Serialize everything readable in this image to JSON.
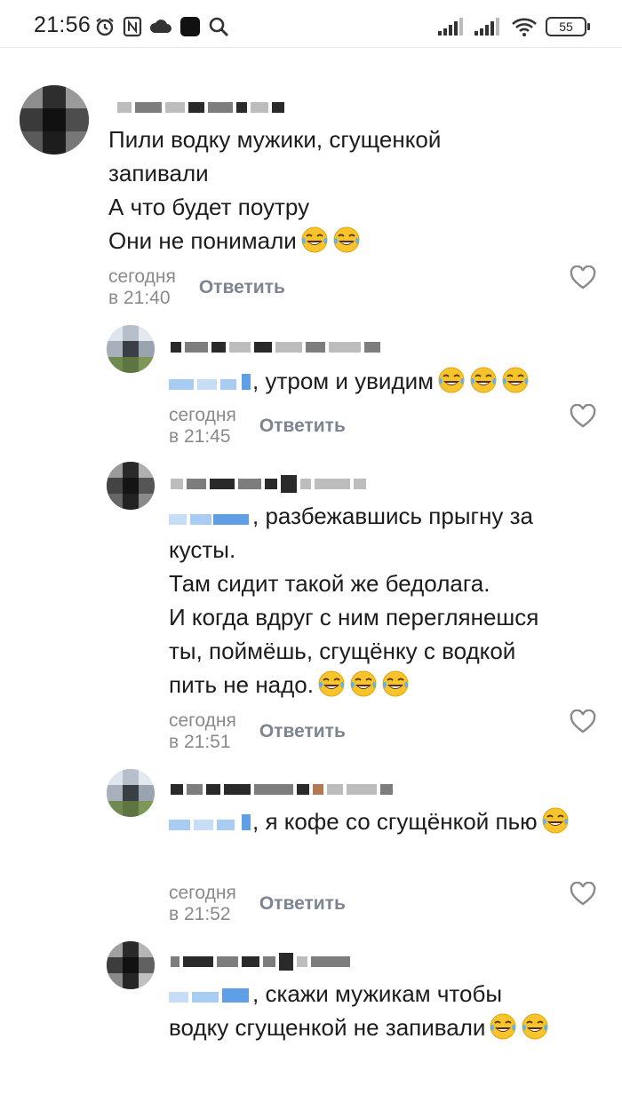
{
  "status_bar": {
    "time": "21:56",
    "left_icons": [
      "alarm-icon",
      "nfc-icon",
      "cloud-icon",
      "app-icon",
      "search-icon"
    ],
    "right_icons": [
      "signal-icon",
      "signal-icon",
      "wifi-icon"
    ],
    "battery": "55"
  },
  "reply_label": "Ответить",
  "comments": [
    {
      "text": "Пили водку мужики, сгущенкой\nзапивали\nА что будет поутру\nОни не понимали",
      "emoji_count": 2,
      "time": "сегодня в 21:40",
      "reply": "Ответить"
    },
    {
      "text": ", утром и увидим",
      "emoji_count": 3,
      "time": "сегодня в 21:45",
      "reply": "Ответить"
    },
    {
      "text": ", разбежавшись прыгну за\nкусты.\nТам сидит такой же бедолага.\nИ когда вдруг с ним переглянешся\nты, поймёшь, сгущёнку с водкой\nпить не надо.",
      "emoji_count": 3,
      "time": "сегодня в 21:51",
      "reply": "Ответить"
    },
    {
      "text": ", я кофе со сгущёнкой пью",
      "emoji_count": 1,
      "time": "сегодня в 21:52",
      "reply": "Ответить"
    },
    {
      "text": ", скажи мужикам чтобы\nводку сгущенкой не запивали",
      "emoji_count": 2,
      "time": "",
      "reply": ""
    }
  ]
}
